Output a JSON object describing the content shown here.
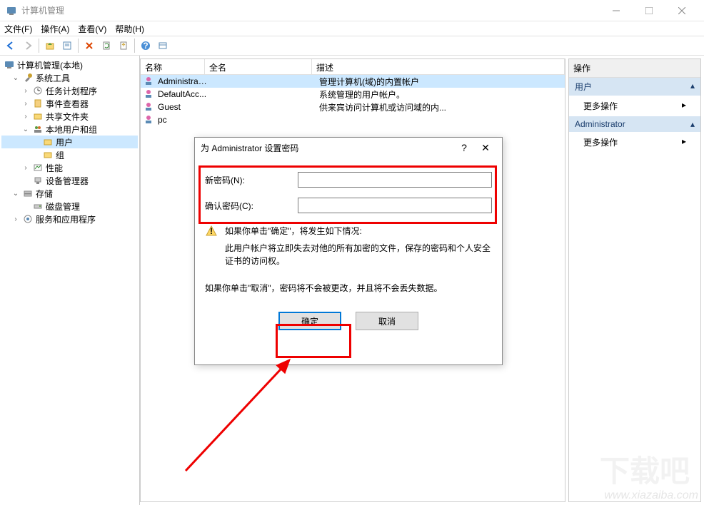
{
  "window": {
    "title": "计算机管理"
  },
  "menu": {
    "file": "文件(F)",
    "action": "操作(A)",
    "view": "查看(V)",
    "help": "帮助(H)"
  },
  "tree": {
    "root": "计算机管理(本地)",
    "systools": "系统工具",
    "task": "任务计划程序",
    "event": "事件查看器",
    "shared": "共享文件夹",
    "localusers": "本地用户和组",
    "users": "用户",
    "groups": "组",
    "perf": "性能",
    "devmgr": "设备管理器",
    "storage": "存储",
    "diskmgr": "磁盘管理",
    "services": "服务和应用程序"
  },
  "list": {
    "col_name": "名称",
    "col_full": "全名",
    "col_desc": "描述",
    "rows": [
      {
        "name": "Administrat...",
        "full": "",
        "desc": "管理计算机(域)的内置帐户"
      },
      {
        "name": "DefaultAcc...",
        "full": "",
        "desc": "系统管理的用户帐户。"
      },
      {
        "name": "Guest",
        "full": "",
        "desc": "供来宾访问计算机或访问域的内..."
      },
      {
        "name": "pc",
        "full": "",
        "desc": ""
      }
    ]
  },
  "actions": {
    "header": "操作",
    "block1": "用户",
    "more": "更多操作",
    "block2": "Administrator"
  },
  "dialog": {
    "title": "为 Administrator 设置密码",
    "new_pwd": "新密码(N):",
    "confirm_pwd": "确认密码(C):",
    "warn": "如果你单击\"确定\"，将发生如下情况:",
    "warn2": "此用户帐户将立即失去对他的所有加密的文件，保存的密码和个人安全证书的访问权。",
    "info": "如果你单击\"取消\"，密码将不会被更改，并且将不会丢失数据。",
    "ok": "确定",
    "cancel": "取消"
  },
  "watermark": "www.xiazaiba.com",
  "logo": "下载吧"
}
